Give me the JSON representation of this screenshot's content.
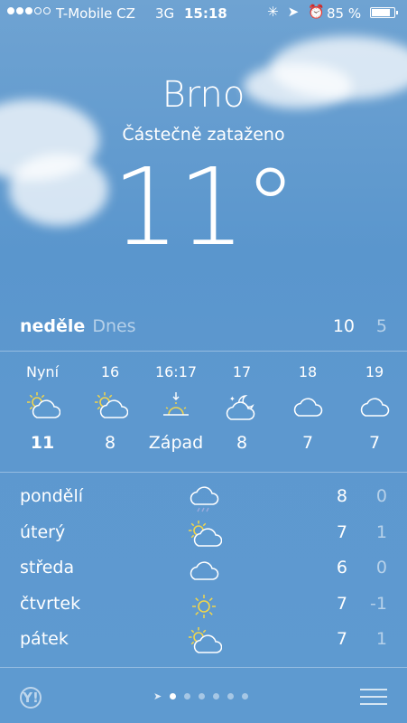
{
  "status_bar": {
    "carrier": "T-Mobile CZ",
    "network": "3G",
    "time": "15:18",
    "battery": "85 %",
    "battery_level": 0.85,
    "signal_bars_filled": 3,
    "signal_bars_total": 5
  },
  "location": {
    "city": "Brno",
    "condition": "Částečně zataženo",
    "temperature": "11°"
  },
  "today": {
    "day": "neděle",
    "label": "Dnes",
    "high": "10",
    "low": "5"
  },
  "hourly": [
    {
      "time": "Nyní",
      "icon": "partly-sunny-icon",
      "value": "11"
    },
    {
      "time": "16",
      "icon": "partly-sunny-icon",
      "value": "8"
    },
    {
      "time": "16:17",
      "icon": "sunset-icon",
      "value": "Západ"
    },
    {
      "time": "17",
      "icon": "partly-cloudy-night-icon",
      "value": "8"
    },
    {
      "time": "18",
      "icon": "cloud-icon",
      "value": "7"
    },
    {
      "time": "19",
      "icon": "cloud-icon",
      "value": "7"
    }
  ],
  "daily": [
    {
      "day": "pondělí",
      "icon": "rain-cloud-icon",
      "high": "8",
      "low": "0"
    },
    {
      "day": "úterý",
      "icon": "partly-sunny-icon",
      "high": "7",
      "low": "1"
    },
    {
      "day": "středa",
      "icon": "cloud-icon",
      "high": "6",
      "low": "0"
    },
    {
      "day": "čtvrtek",
      "icon": "sun-icon",
      "high": "7",
      "low": "-1"
    },
    {
      "day": "pátek",
      "icon": "partly-sunny-icon",
      "high": "7",
      "low": "1"
    }
  ],
  "footer": {
    "yahoo_logo": "Y!",
    "page_count": 6,
    "active_page": 0
  },
  "colors": {
    "sun": "#f3d64a",
    "background": "#5e9ad0"
  }
}
